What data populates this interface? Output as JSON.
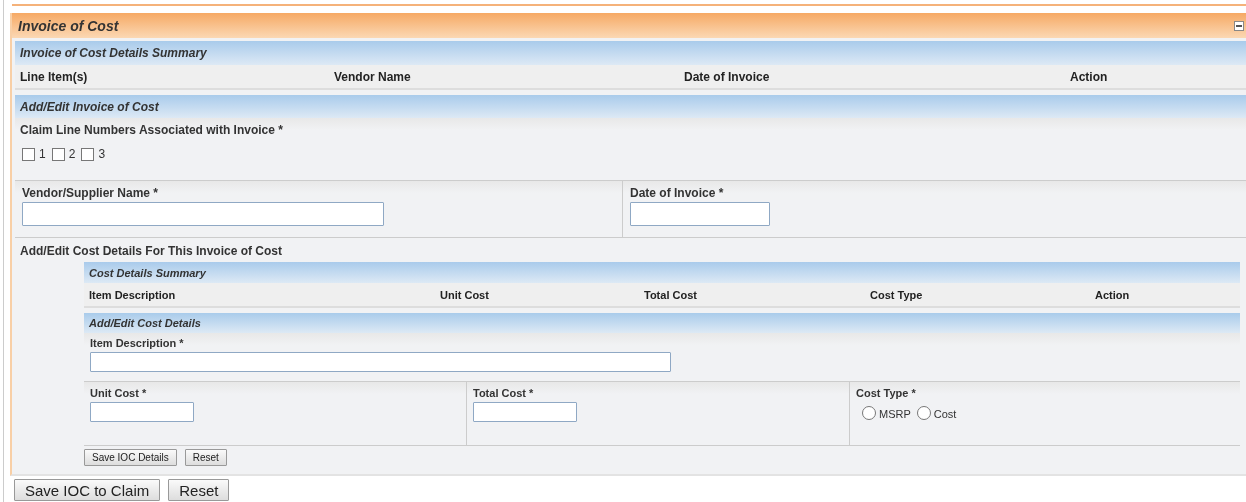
{
  "panel": {
    "title": "Invoice of Cost"
  },
  "summary": {
    "title": "Invoice of Cost Details Summary",
    "columns": [
      "Line Item(s)",
      "Vendor Name",
      "Date of Invoice",
      "Action"
    ]
  },
  "edit": {
    "title": "Add/Edit Invoice of Cost",
    "claim_lines": {
      "label": "Claim Line Numbers Associated with Invoice *",
      "options": [
        {
          "label": "1",
          "checked": false
        },
        {
          "label": "2",
          "checked": false
        },
        {
          "label": "3",
          "checked": false
        }
      ]
    },
    "vendor": {
      "label": "Vendor/Supplier Name *"
    },
    "date": {
      "label": "Date of Invoice *"
    }
  },
  "cost_details": {
    "title": "Add/Edit Cost Details For This Invoice of Cost",
    "summary": {
      "title": "Cost Details Summary",
      "columns": [
        "Item Description",
        "Unit Cost",
        "Total Cost",
        "Cost Type",
        "Action"
      ]
    },
    "edit": {
      "title": "Add/Edit Cost Details",
      "item_description": {
        "label": "Item Description *"
      },
      "unit_cost": {
        "label": "Unit Cost *"
      },
      "total_cost": {
        "label": "Total Cost *"
      },
      "cost_type": {
        "label": "Cost Type *",
        "options": [
          {
            "label": "MSRP",
            "selected": false
          },
          {
            "label": "Cost",
            "selected": false
          }
        ]
      }
    },
    "buttons": [
      "Save IOC Details",
      "Reset"
    ]
  },
  "buttons": [
    "Save IOC to Claim",
    "Reset"
  ]
}
